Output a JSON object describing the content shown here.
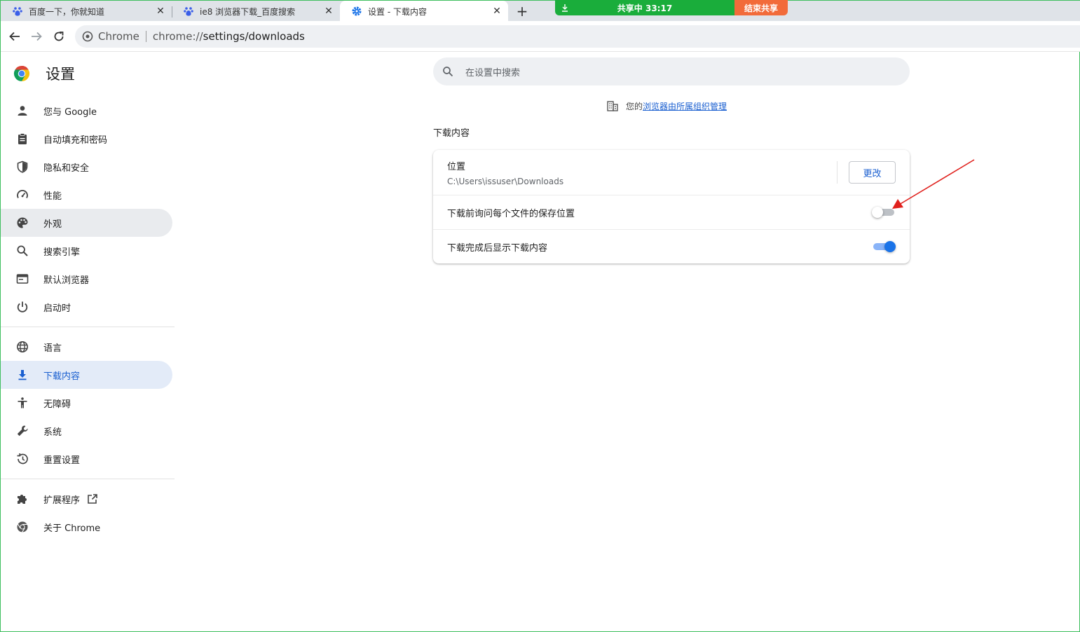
{
  "tabs": [
    {
      "title": "百度一下，你就知道",
      "icon": "baidu-paw-icon"
    },
    {
      "title": "ie8 浏览器下载_百度搜索",
      "icon": "baidu-paw-icon"
    },
    {
      "title": "设置 - 下载内容",
      "icon": "gear-icon"
    }
  ],
  "sharebar": {
    "status": "共享中  33:17",
    "end_label": "结束共享",
    "colors": {
      "left": "#1aad3b",
      "right": "#f26b3a"
    }
  },
  "omnibox": {
    "chip": "Chrome",
    "url_host": "chrome://",
    "url_path": "settings/downloads"
  },
  "brand": {
    "title": "设置"
  },
  "sidebar": {
    "items": [
      {
        "label": "您与 Google",
        "icon": "person-icon"
      },
      {
        "label": "自动填充和密码",
        "icon": "clipboard-icon"
      },
      {
        "label": "隐私和安全",
        "icon": "shield-icon"
      },
      {
        "label": "性能",
        "icon": "speedometer-icon"
      },
      {
        "label": "外观",
        "icon": "palette-icon"
      },
      {
        "label": "搜索引擎",
        "icon": "search-icon"
      },
      {
        "label": "默认浏览器",
        "icon": "browser-window-icon"
      },
      {
        "label": "启动时",
        "icon": "power-icon"
      },
      {
        "label": "语言",
        "icon": "globe-icon"
      },
      {
        "label": "下载内容",
        "icon": "download-icon"
      },
      {
        "label": "无障碍",
        "icon": "accessibility-icon"
      },
      {
        "label": "系统",
        "icon": "wrench-icon"
      },
      {
        "label": "重置设置",
        "icon": "restore-icon"
      },
      {
        "label": "扩展程序",
        "icon": "puzzle-icon"
      },
      {
        "label": "关于 Chrome",
        "icon": "chrome-logo-icon"
      }
    ]
  },
  "search": {
    "placeholder": "在设置中搜索"
  },
  "managed": {
    "prefix": "您的",
    "link": "浏览器由所属组织管理"
  },
  "section": {
    "title": "下载内容"
  },
  "downloads": {
    "location_label": "位置",
    "location_path": "C:\\Users\\issuser\\Downloads",
    "change_button": "更改",
    "ask_label": "下载前询问每个文件的保存位置",
    "ask_enabled": false,
    "show_label": "下载完成后显示下载内容",
    "show_enabled": true
  },
  "colors": {
    "accent": "#1a73e8",
    "selected_bg": "#e3ebf8",
    "annotation_arrow": "#e0201c"
  }
}
